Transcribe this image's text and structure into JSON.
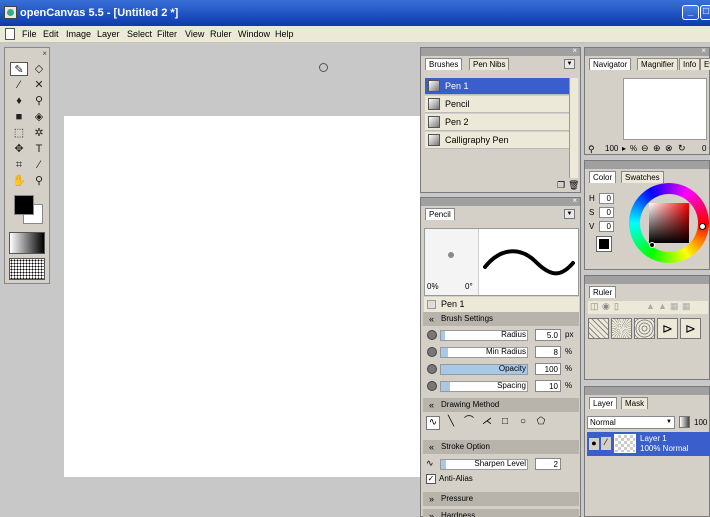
{
  "window": {
    "title": "openCanvas 5.5 - [Untitled 2 *]",
    "minimize_glyph": "_",
    "restore_glyph": "□"
  },
  "menu": [
    "File",
    "Edit",
    "Image",
    "Layer",
    "Select",
    "Filter",
    "View",
    "Ruler",
    "Window",
    "Help"
  ],
  "toolbox": {
    "close": "×",
    "tools": [
      {
        "name": "pen-tool-icon",
        "glyph": "✎"
      },
      {
        "name": "eraser-tool-icon",
        "glyph": "◇"
      },
      {
        "name": "brush-tool-icon",
        "glyph": "⁄"
      },
      {
        "name": "airbrush-tool-icon",
        "glyph": "✕"
      },
      {
        "name": "blur-tool-icon",
        "glyph": "♦"
      },
      {
        "name": "water-tool-icon",
        "glyph": "⚲"
      },
      {
        "name": "fill-tool-icon",
        "glyph": "■"
      },
      {
        "name": "bucket-tool-icon",
        "glyph": "◈"
      },
      {
        "name": "select-tool-icon",
        "glyph": "⬚"
      },
      {
        "name": "magic-wand-icon",
        "glyph": "✲"
      },
      {
        "name": "move-tool-icon",
        "glyph": "✥"
      },
      {
        "name": "text-tool-icon",
        "glyph": "T"
      },
      {
        "name": "crop-tool-icon",
        "glyph": "⌗"
      },
      {
        "name": "eyedropper-icon",
        "glyph": "⁄"
      },
      {
        "name": "hand-tool-icon",
        "glyph": "✋"
      },
      {
        "name": "zoom-tool-icon",
        "glyph": "⚲"
      }
    ]
  },
  "brushes_panel": {
    "close": "×",
    "tabs": [
      "Brushes",
      "Pen Nibs"
    ],
    "items": [
      "Pen 1",
      "Pencil",
      "Pen 2",
      "Calligraphy Pen"
    ],
    "selected": "Pen 1"
  },
  "pencil_panel": {
    "tab": "Pencil",
    "preview_left": "0%",
    "preview_right": "0°",
    "nib_name": "Pen 1",
    "sections": {
      "brush_settings": "Brush Settings",
      "drawing_method": "Drawing Method",
      "stroke_option": "Stroke Option",
      "pressure": "Pressure",
      "hardness": "Hardness"
    },
    "sliders": [
      {
        "label": "Radius",
        "value": "5.0",
        "unit": "px",
        "fill": 0.05
      },
      {
        "label": "Min Radius",
        "value": "8",
        "unit": "%",
        "fill": 0.08
      },
      {
        "label": "Opacity",
        "value": "100",
        "unit": "%",
        "fill": 1.0
      },
      {
        "label": "Spacing",
        "value": "10",
        "unit": "%",
        "fill": 0.1
      }
    ],
    "sharpen_label": "Sharpen Level",
    "sharpen_value": "2",
    "antialias_label": "Anti-Alias",
    "antialias_checked": true
  },
  "navigator_panel": {
    "close": "×",
    "tabs": [
      "Navigator",
      "Magnifier",
      "Info",
      "Eve"
    ],
    "zoom": "100",
    "zoom_unit": "%",
    "rotation": "0"
  },
  "color_panel": {
    "tabs": [
      "Color",
      "Swatches"
    ],
    "h_label": "H",
    "h_value": "0",
    "s_label": "S",
    "s_value": "0",
    "v_label": "V",
    "v_value": "0",
    "accent": "#ff0000"
  },
  "ruler_panel": {
    "tab": "Ruler"
  },
  "layer_panel": {
    "tabs": [
      "Layer",
      "Mask"
    ],
    "blend_mode": "Normal",
    "opacity": "100",
    "layer_name": "Layer 1",
    "layer_desc": "100% Normal"
  }
}
